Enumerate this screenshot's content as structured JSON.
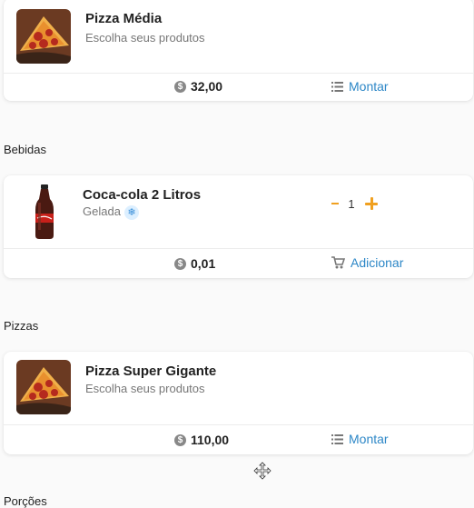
{
  "products": {
    "pizza_media": {
      "name": "Pizza Média",
      "subtitle": "Escolha seus produtos",
      "price": "32,00",
      "action": "Montar"
    },
    "coca_cola": {
      "name": "Coca-cola 2 Litros",
      "subtitle": "Gelada",
      "price": "0,01",
      "action": "Adicionar",
      "quantity": "1",
      "minus_symbol": "-",
      "plus_symbol": "+"
    },
    "pizza_super_gigante": {
      "name": "Pizza Super Gigante",
      "subtitle": "Escolha seus produtos",
      "price": "110,00",
      "action": "Montar"
    }
  },
  "sections": {
    "bebidas": "Bebidas",
    "pizzas": "Pizzas",
    "porcoes": "Porções"
  },
  "colors": {
    "accent": "#f0a020",
    "link": "#2d87c7",
    "muted": "#777777"
  },
  "icons": {
    "price": "dollar-coin-icon",
    "montar": "list-icon",
    "adicionar": "cart-icon",
    "gelada": "snowflake-icon",
    "cursor": "move-cursor-icon"
  }
}
